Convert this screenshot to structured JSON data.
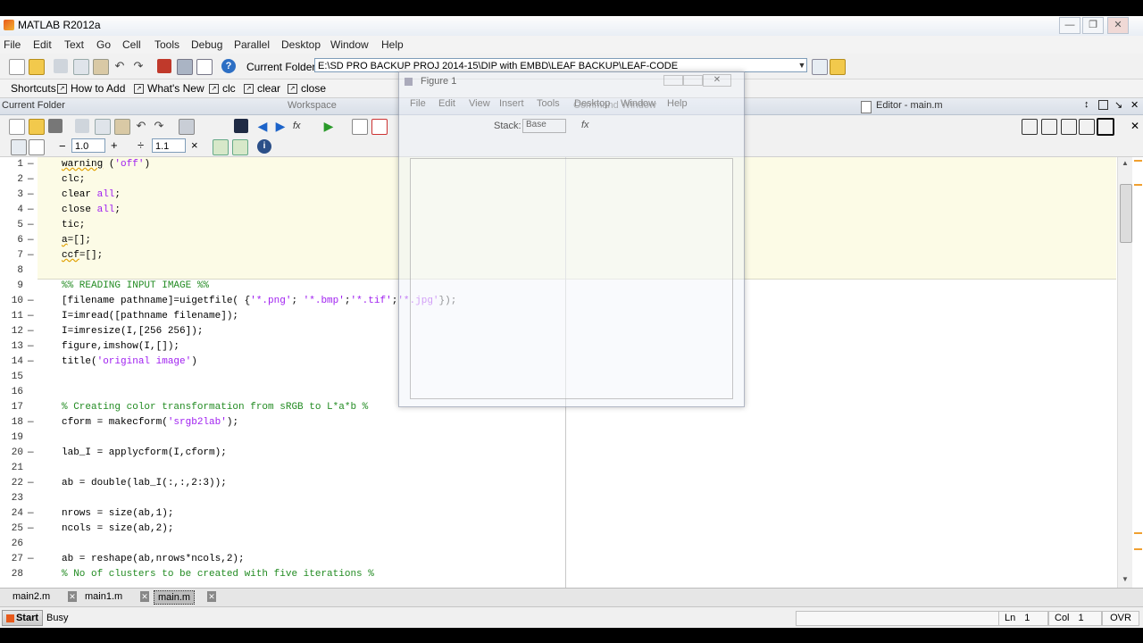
{
  "window": {
    "title": "MATLAB  R2012a",
    "controls": [
      "—",
      "❐",
      "✕"
    ]
  },
  "menubar": [
    "File",
    "Edit",
    "Text",
    "Go",
    "Cell",
    "Tools",
    "Debug",
    "Parallel",
    "Desktop",
    "Window",
    "Help"
  ],
  "toolbar": {
    "current_folder_label": "Current Folder:",
    "current_folder_value": "E:\\SD PRO BACKUP PROJ 2014-15\\DIP with EMBD\\LEAF BACKUP\\LEAF-CODE"
  },
  "shortcuts": {
    "label": "Shortcuts",
    "items": [
      "How to Add",
      "What's New",
      "clc",
      "clear",
      "close"
    ]
  },
  "panels": {
    "current_folder": "Current Folder",
    "workspace": "Workspace",
    "command_window": "Command Window",
    "editor": "Editor - main.m"
  },
  "cell_toolbar": {
    "minus": "−",
    "value1": "1.0",
    "plus": "+",
    "divide": "÷",
    "value2": "1.1",
    "times": "×"
  },
  "editor_lines": [
    {
      "n": "1",
      "dash": "—"
    },
    {
      "n": "2",
      "dash": "—"
    },
    {
      "n": "3",
      "dash": "—"
    },
    {
      "n": "4",
      "dash": "—"
    },
    {
      "n": "5",
      "dash": "—"
    },
    {
      "n": "6",
      "dash": "—"
    },
    {
      "n": "7",
      "dash": "—"
    },
    {
      "n": "8",
      "dash": ""
    },
    {
      "n": "9",
      "dash": ""
    },
    {
      "n": "10",
      "dash": "—"
    },
    {
      "n": "11",
      "dash": "—"
    },
    {
      "n": "12",
      "dash": "—"
    },
    {
      "n": "13",
      "dash": "—"
    },
    {
      "n": "14",
      "dash": "—"
    },
    {
      "n": "15",
      "dash": ""
    },
    {
      "n": "16",
      "dash": ""
    },
    {
      "n": "17",
      "dash": ""
    },
    {
      "n": "18",
      "dash": "—"
    },
    {
      "n": "19",
      "dash": ""
    },
    {
      "n": "20",
      "dash": "—"
    },
    {
      "n": "21",
      "dash": ""
    },
    {
      "n": "22",
      "dash": "—"
    },
    {
      "n": "23",
      "dash": ""
    },
    {
      "n": "24",
      "dash": "—"
    },
    {
      "n": "25",
      "dash": "—"
    },
    {
      "n": "26",
      "dash": ""
    },
    {
      "n": "27",
      "dash": "—"
    },
    {
      "n": "28",
      "dash": ""
    }
  ],
  "code": {
    "l1a": "warning",
    "l1b": " (",
    "l1c": "'off'",
    "l1d": ")",
    "l2": "clc;",
    "l3a": "clear ",
    "l3b": "all",
    "l3c": ";",
    "l4a": "close ",
    "l4b": "all",
    "l4c": ";",
    "l5": "tic;",
    "l6a": "a",
    "l6b": "=[];",
    "l7a": "ccf",
    "l7b": "=[];",
    "l9": "%% READING INPUT IMAGE %%",
    "l10a": "[filename pathname]=uigetfile( {",
    "l10b": "'*.png'",
    "l10c": "; ",
    "l10d": "'*.bmp'",
    "l10e": ";",
    "l10f": "'*.tif'",
    "l10g": ";",
    "l10h": "'*.jpg'",
    "l10i": "});",
    "l11": "I=imread([pathname filename]);",
    "l12": "I=imresize(I,[256 256]);",
    "l13": "figure,imshow(I,[]);",
    "l14a": "title(",
    "l14b": "'original image'",
    "l14c": ")",
    "l17": "% Creating color transformation from sRGB to L*a*b %",
    "l18a": "cform = makecform(",
    "l18b": "'srgb2lab'",
    "l18c": ");",
    "l20": "lab_I = applycform(I,cform);",
    "l22": "ab = double(lab_I(:,:,2:3));",
    "l24": "nrows = size(ab,1);",
    "l25": "ncols = size(ab,2);",
    "l27": "ab = reshape(ab,nrows*ncols,2);",
    "l28": "% No of clusters to be created with five iterations %"
  },
  "file_tabs": [
    "main2.m",
    "main1.m",
    "main.m"
  ],
  "status": {
    "start": "Start",
    "state": "Busy",
    "ln_label": "Ln",
    "ln_value": "1",
    "col_label": "Col",
    "col_value": "1",
    "mode": "OVR"
  },
  "figure": {
    "title": "Figure 1",
    "menu": [
      "File",
      "Edit",
      "View",
      "Insert",
      "Tools",
      "Desktop",
      "Window",
      "Help"
    ],
    "stack_label": "Stack:",
    "stack_value": "Base",
    "fx": "fx"
  }
}
